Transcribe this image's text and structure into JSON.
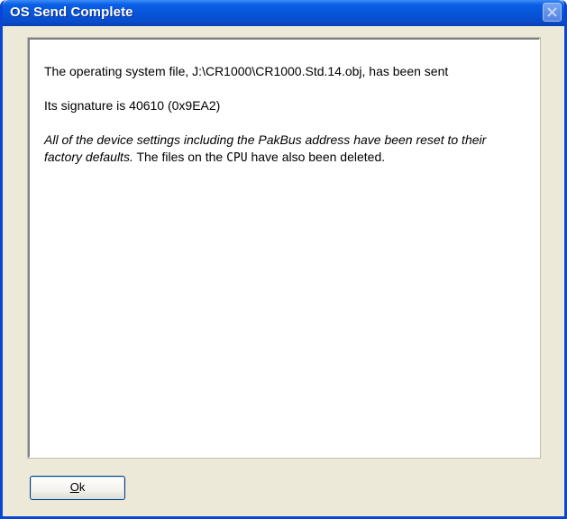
{
  "window": {
    "title": "OS Send Complete",
    "close_icon": "close-icon"
  },
  "message": {
    "line1": "The operating system file, J:\\CR1000\\CR1000.Std.14.obj, has been sent",
    "line2": "Its signature is 40610 (0x9EA2)",
    "warning_italic": "All of the device settings including the PakBus address have been reset to their factory defaults.",
    "files_prefix": " The files on the ",
    "cpu": "CPU",
    "files_suffix": " have also been deleted."
  },
  "buttons": {
    "ok_mnemonic": "O",
    "ok_rest": "k"
  },
  "colors": {
    "titlebar": "#0653d8",
    "frame": "#0a46d6",
    "dialog_bg": "#ece9d8"
  }
}
